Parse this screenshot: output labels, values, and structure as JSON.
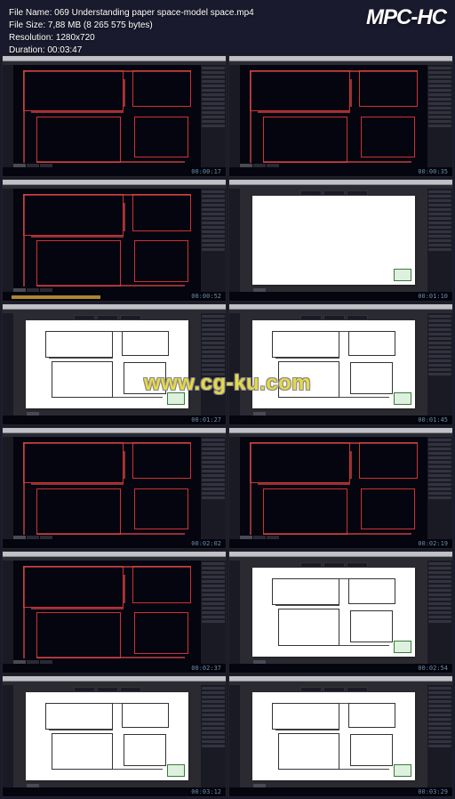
{
  "header": {
    "filename_label": "File Name:",
    "filename": "069 Understanding paper space-model space.mp4",
    "filesize_label": "File Size:",
    "filesize": "7,88 MB (8 265 575 bytes)",
    "resolution_label": "Resolution:",
    "resolution": "1280x720",
    "duration_label": "Duration:",
    "duration": "00:03:47"
  },
  "logo": "MPC-HC",
  "watermark": "www.cg-ku.com",
  "thumbnails": [
    {
      "time": "00:00:17",
      "mode": "model",
      "highlight": false
    },
    {
      "time": "00:00:35",
      "mode": "model",
      "highlight": false
    },
    {
      "time": "00:00:52",
      "mode": "model",
      "highlight": true
    },
    {
      "time": "00:01:10",
      "mode": "paper-blank",
      "highlight": false
    },
    {
      "time": "00:01:27",
      "mode": "paper-plan",
      "highlight": false
    },
    {
      "time": "00:01:45",
      "mode": "paper-plan",
      "highlight": false
    },
    {
      "time": "00:02:02",
      "mode": "model",
      "highlight": false
    },
    {
      "time": "00:02:19",
      "mode": "model",
      "highlight": false
    },
    {
      "time": "00:02:37",
      "mode": "model",
      "highlight": false
    },
    {
      "time": "00:02:54",
      "mode": "paper-plan",
      "highlight": false
    },
    {
      "time": "00:03:12",
      "mode": "paper-plan",
      "highlight": false
    },
    {
      "time": "00:03:29",
      "mode": "paper-plan",
      "highlight": false
    }
  ]
}
